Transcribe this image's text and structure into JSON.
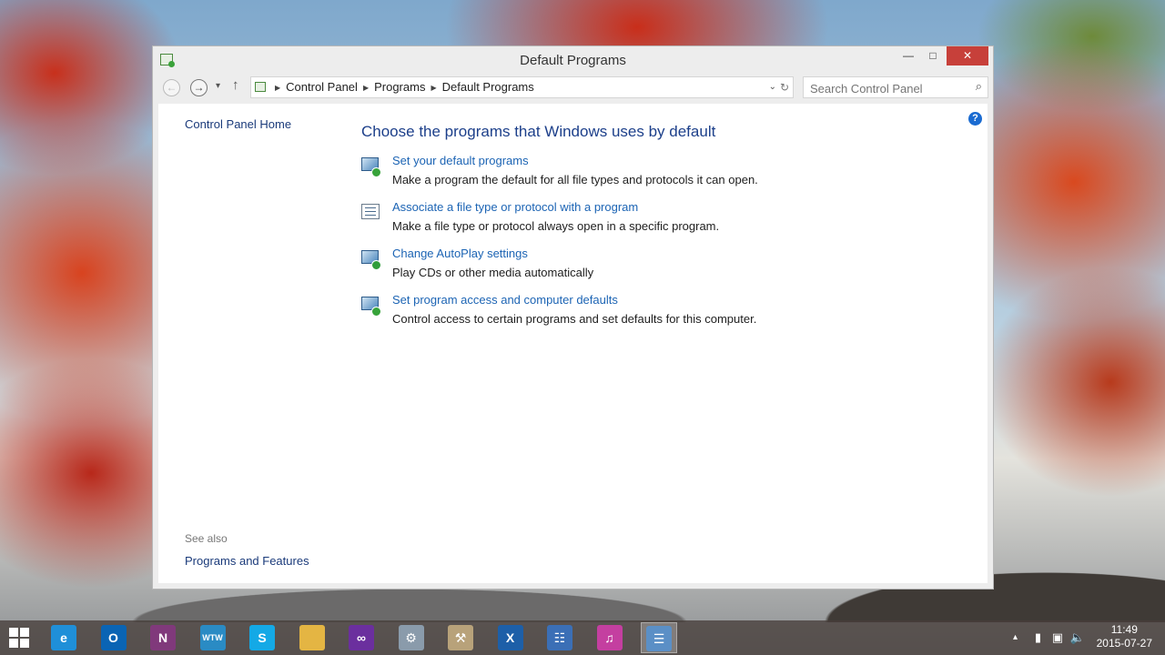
{
  "window": {
    "title": "Default Programs",
    "controls": {
      "minimize": "—",
      "maximize": "□",
      "close": "✕"
    }
  },
  "address": {
    "back": "←",
    "forward": "→",
    "history": "▾",
    "up": "↑",
    "crumbs": [
      "Control Panel",
      "Programs",
      "Default Programs"
    ],
    "separator": "▶",
    "dropdown": "⌄",
    "refresh": "↻"
  },
  "search": {
    "placeholder": "Search Control Panel",
    "icon": "⌕"
  },
  "help": "?",
  "sidebar": {
    "home": "Control Panel Home",
    "see_also": "See also",
    "links": [
      "Programs and Features"
    ]
  },
  "main": {
    "heading": "Choose the programs that Windows uses by default",
    "tasks": [
      {
        "icon": "default-programs-icon",
        "link": "Set your default programs",
        "desc": "Make a program the default for all file types and protocols it can open."
      },
      {
        "icon": "file-association-icon",
        "link": "Associate a file type or protocol with a program",
        "desc": "Make a file type or protocol always open in a specific program."
      },
      {
        "icon": "autoplay-icon",
        "link": "Change AutoPlay settings",
        "desc": "Play CDs or other media automatically"
      },
      {
        "icon": "program-access-icon",
        "link": "Set program access and computer defaults",
        "desc": "Control access to certain programs and set defaults for this computer."
      }
    ]
  },
  "taskbar": {
    "apps": [
      {
        "name": "internet-explorer-icon",
        "glyph": "e",
        "color": "#1f8fd8"
      },
      {
        "name": "outlook-icon",
        "glyph": "O",
        "color": "#0a64b4"
      },
      {
        "name": "onenote-icon",
        "glyph": "N",
        "color": "#80397b"
      },
      {
        "name": "wtw-icon",
        "glyph": "WTW",
        "color": "#2a8bc4"
      },
      {
        "name": "skype-icon",
        "glyph": "S",
        "color": "#14a9e6"
      },
      {
        "name": "file-explorer-icon",
        "glyph": "",
        "color": "#e4b543"
      },
      {
        "name": "visual-studio-icon",
        "glyph": "∞",
        "color": "#6b2f9e"
      },
      {
        "name": "network-tool-icon",
        "glyph": "⚙",
        "color": "#8a9bab"
      },
      {
        "name": "tools-icon",
        "glyph": "⚒",
        "color": "#b8a27a"
      },
      {
        "name": "xmanager-icon",
        "glyph": "X",
        "color": "#1d5fa8"
      },
      {
        "name": "remote-desktop-icon",
        "glyph": "☷",
        "color": "#3b6fb6"
      },
      {
        "name": "itunes-icon",
        "glyph": "♫",
        "color": "#c43fa0"
      },
      {
        "name": "control-panel-icon",
        "glyph": "☰",
        "color": "#5b8fc6"
      }
    ],
    "tray": {
      "arrow": "▴",
      "time": "11:49",
      "date": "2015-07-27"
    }
  }
}
